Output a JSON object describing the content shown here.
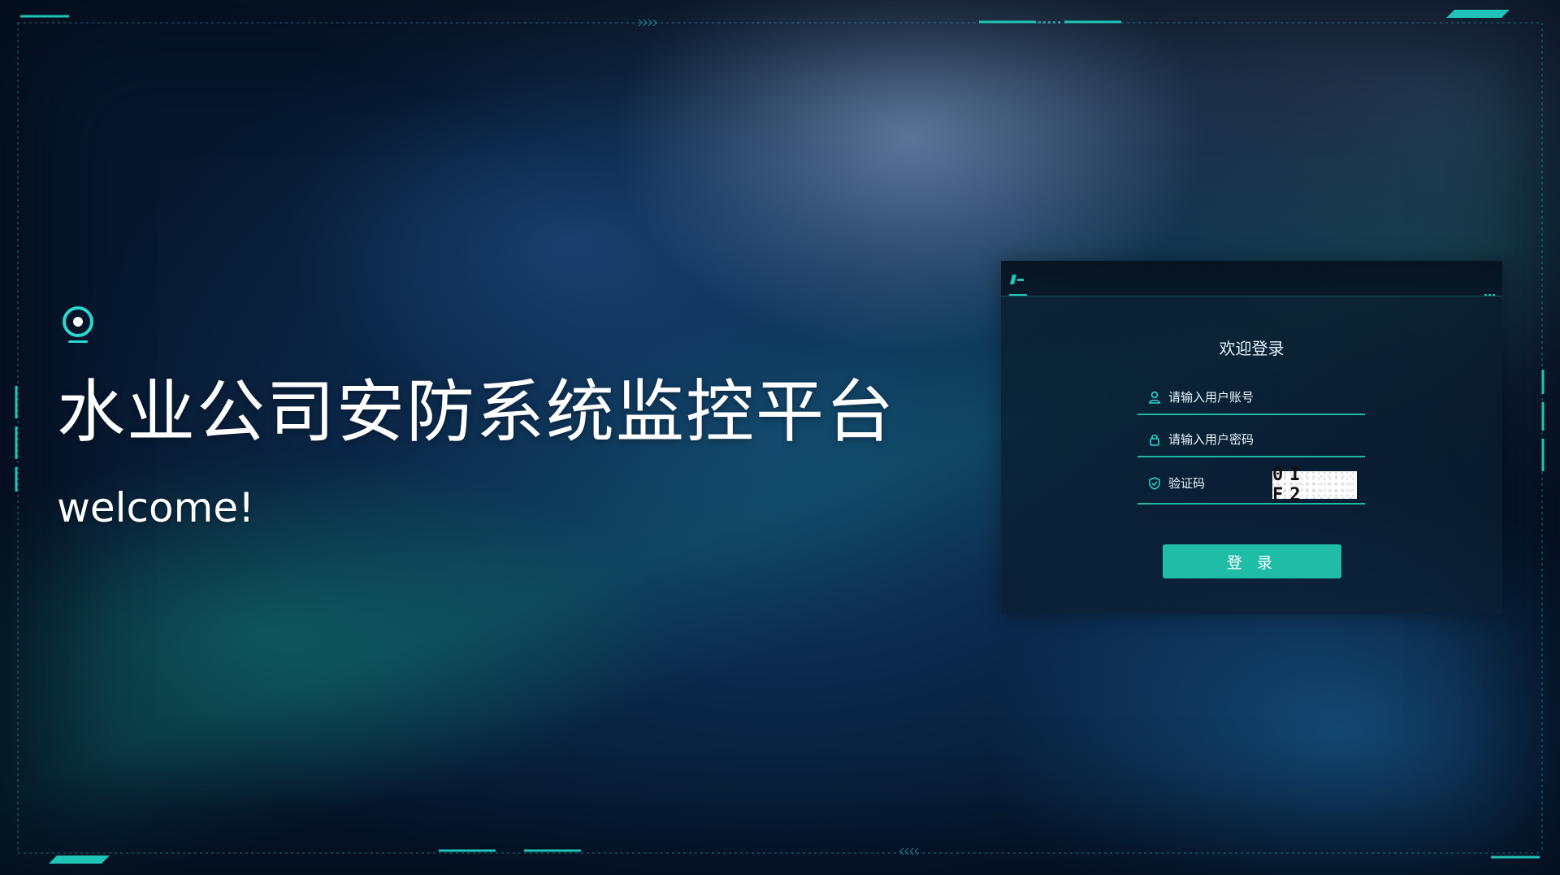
{
  "brand": {
    "title": "水业公司安防系统监控平台",
    "welcome": "welcome!"
  },
  "login": {
    "heading": "欢迎登录",
    "username_placeholder": "请输入用户账号",
    "password_placeholder": "请输入用户密码",
    "captcha_placeholder": "验证码",
    "captcha_code": "0I F2",
    "submit_label": "登 录"
  },
  "icons": {
    "logo": "location-pin-icon",
    "username": "user-icon",
    "password": "lock-icon",
    "captcha": "shield-check-icon"
  },
  "colors": {
    "accent": "#1fbca7",
    "text": "#ffffff"
  }
}
